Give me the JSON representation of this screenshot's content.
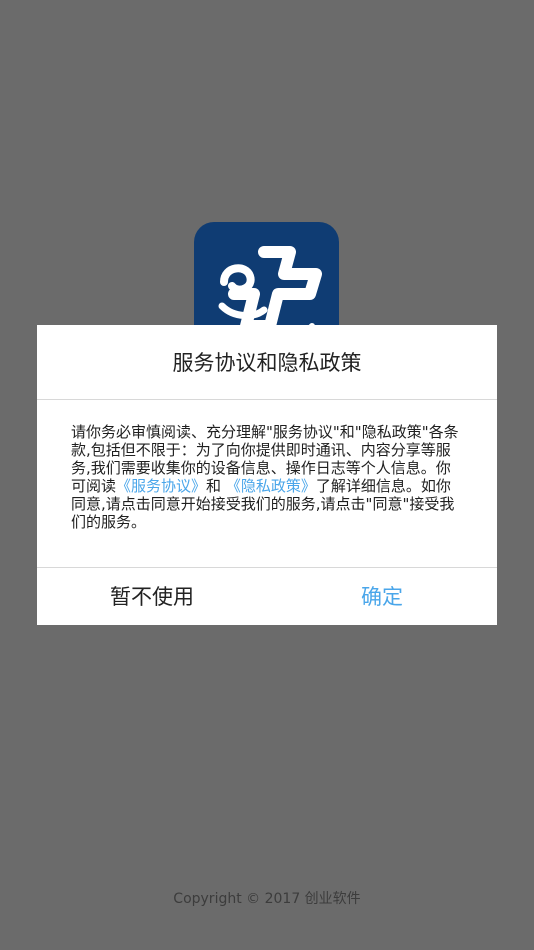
{
  "dialog": {
    "title": "服务协议和隐私政策",
    "body_intro": "请你务必审慎阅读、充分理解\"服务协议\"和\"隐私政策\"各条款,包括但不限于：为了向你提供即时通讯、内容分享等服务,我们需要收集你的设备信息、操作日志等个人信息。你可阅读",
    "service_link": "《服务协议》",
    "connector": "和",
    "privacy_link": "《隐私政策》",
    "body_outro": "了解详细信息。如你同意,请点击同意开始接受我们的服务,请点击\"同意\"接受我们的服务。",
    "decline_label": "暂不使用",
    "confirm_label": "确定"
  },
  "footer": {
    "copyright": "Copyright © 2017 创业软件"
  },
  "colors": {
    "overlay": "#6b6b6b",
    "logo_bg": "#0f3c73",
    "link": "#4aa6ea"
  },
  "icons": {
    "app_logo": "medical-cross-logo-icon"
  }
}
